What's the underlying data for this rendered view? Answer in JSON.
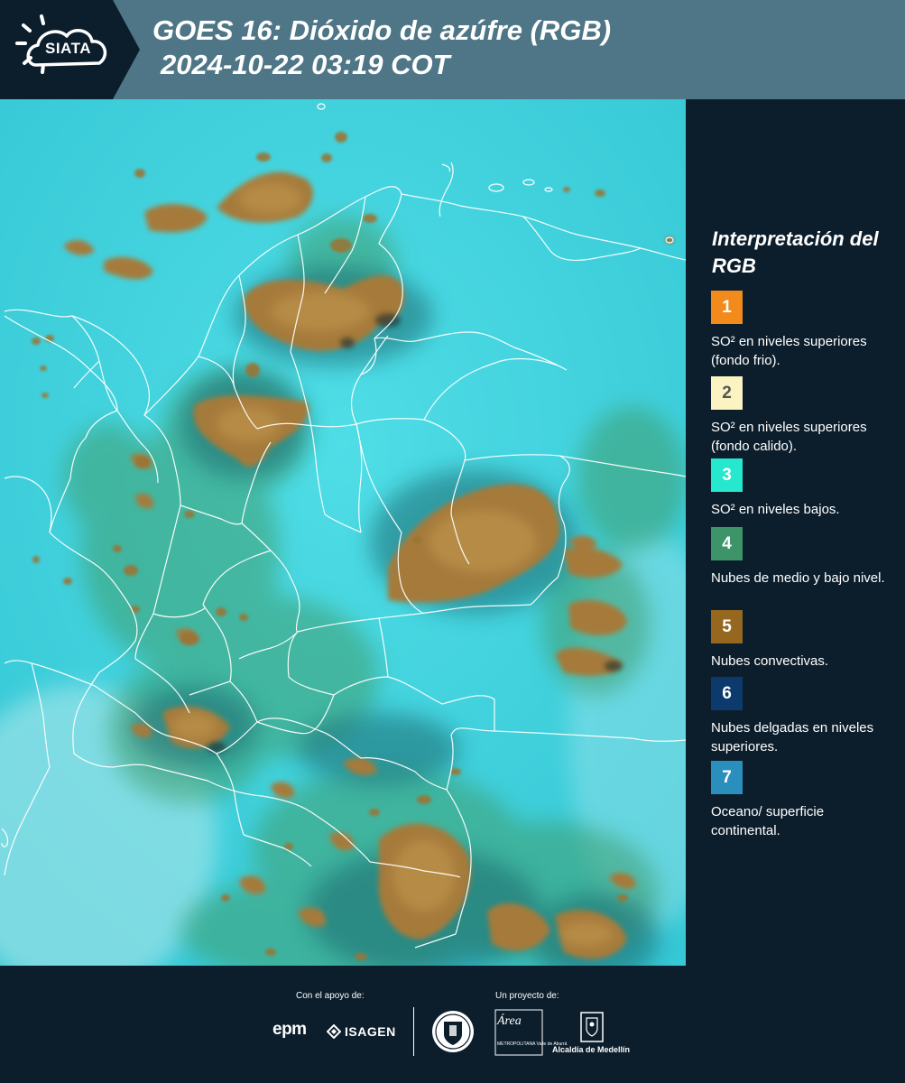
{
  "header": {
    "logo_text": "SIATA",
    "title_line1": "GOES 16: Dióxido de azúfre (RGB)",
    "title_line2": "2024-10-22 03:19 COT",
    "background_color": "#4f7686"
  },
  "map": {
    "icon": "satellite-map",
    "base_color": "#3fd3de",
    "boundary_color": "#ffffff"
  },
  "legend": {
    "title": "Interpretación del RGB",
    "items": [
      {
        "number": "1",
        "color": "#f28a1c",
        "number_color": "#ffffff",
        "text": "SO² en niveles superiores (fondo frio)."
      },
      {
        "number": "2",
        "color": "#fbf3c2",
        "number_color": "#555555",
        "text": "SO² en niveles superiores (fondo calido)."
      },
      {
        "number": "3",
        "color": "#25e8cf",
        "number_color": "#ffffff",
        "text": "SO² en niveles bajos."
      },
      {
        "number": "4",
        "color": "#3c9468",
        "number_color": "#ffffff",
        "text": "Nubes de medio y bajo nivel."
      },
      {
        "number": "5",
        "color": "#96681f",
        "number_color": "#ffffff",
        "text": "Nubes convectivas."
      },
      {
        "number": "6",
        "color": "#0d3a6c",
        "number_color": "#ffffff",
        "text": "Nubes delgadas en niveles superiores."
      },
      {
        "number": "7",
        "color": "#2b8fbe",
        "number_color": "#ffffff",
        "text": "Oceano/ superficie continental."
      }
    ]
  },
  "footer": {
    "support_label": "Con el apoyo de:",
    "project_label": "Un proyecto de:",
    "epm": "epm",
    "isagen": "ISAGEN",
    "area_name": "Área",
    "area_sub": "METROPOLITANA Valle de Aburrá",
    "alcaldia": "Alcaldía de Medellín",
    "seal_icon": "medellin-seal-icon",
    "alcaldia_icon": "alcaldia-building-icon"
  }
}
